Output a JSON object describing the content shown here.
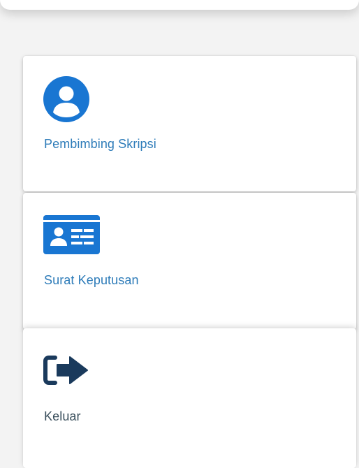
{
  "menu": {
    "items": [
      {
        "label": "Pembimbing Skripsi",
        "icon": "user-circle-icon",
        "color": "#2e7cb9",
        "icon_color": "#1976d2"
      },
      {
        "label": "Surat Keputusan",
        "icon": "id-card-icon",
        "color": "#2e7cb9",
        "icon_color": "#1976d2"
      },
      {
        "label": "Keluar",
        "icon": "sign-out-icon",
        "color": "#3a4f5c",
        "icon_color": "#1a3a5c"
      }
    ]
  }
}
